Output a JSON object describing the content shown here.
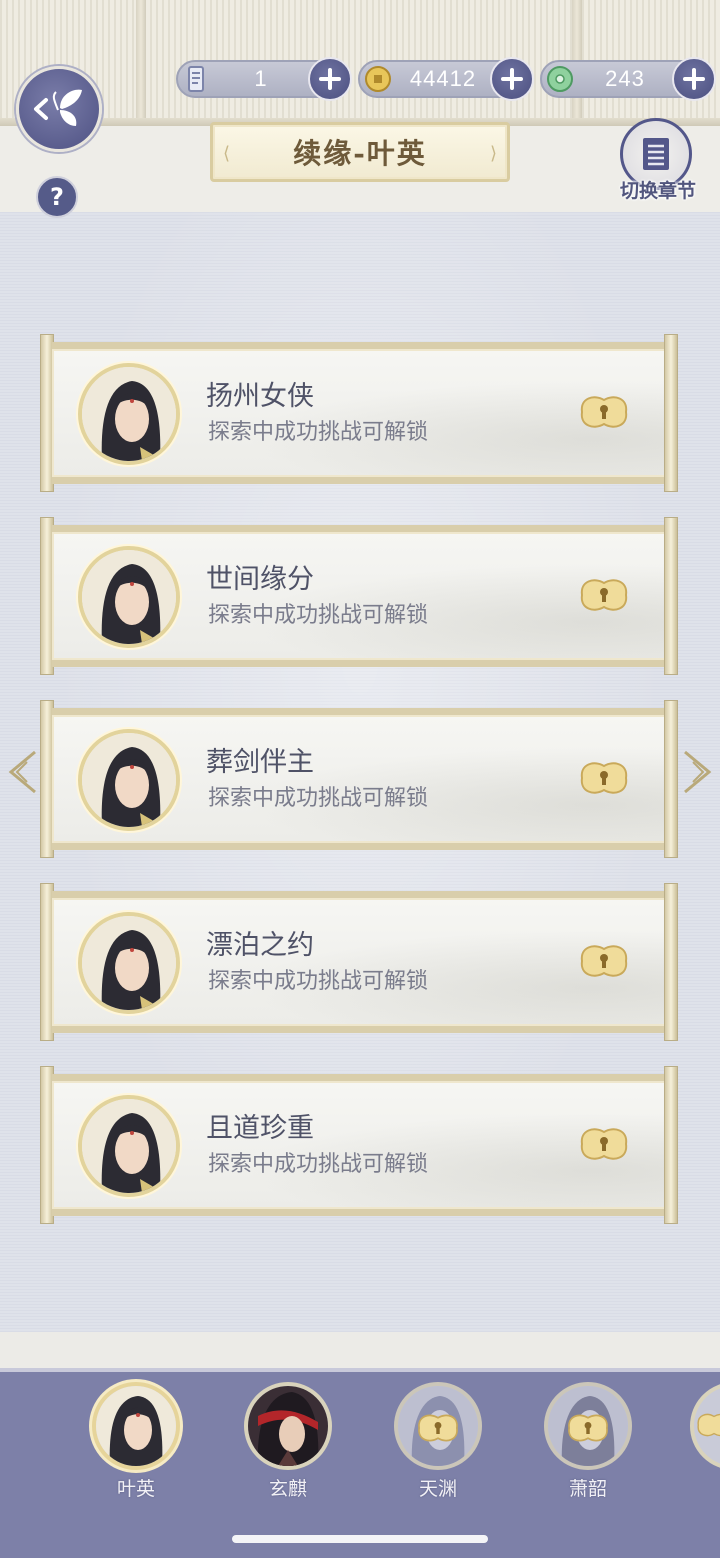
{
  "header": {
    "title": "续缘-叶英",
    "switch_chapter_label": "切换章节"
  },
  "currencies": [
    {
      "name": "scroll-token",
      "icon": "scroll-icon",
      "value": "1"
    },
    {
      "name": "copper-coin",
      "icon": "coin-icon",
      "value": "44412"
    },
    {
      "name": "jade",
      "icon": "jade-icon",
      "value": "243"
    }
  ],
  "stories": [
    {
      "title": "扬州女侠",
      "hint": "探索中成功挑战可解锁",
      "locked": true
    },
    {
      "title": "世间缘分",
      "hint": "探索中成功挑战可解锁",
      "locked": true
    },
    {
      "title": "葬剑伴主",
      "hint": "探索中成功挑战可解锁",
      "locked": true
    },
    {
      "title": "漂泊之约",
      "hint": "探索中成功挑战可解锁",
      "locked": true
    },
    {
      "title": "且道珍重",
      "hint": "探索中成功挑战可解锁",
      "locked": true
    }
  ],
  "characters": [
    {
      "name": "叶英",
      "active": true,
      "locked": false
    },
    {
      "name": "玄麒",
      "active": false,
      "locked": false
    },
    {
      "name": "天渊",
      "active": false,
      "locked": true
    },
    {
      "name": "萧韶",
      "active": false,
      "locked": true
    }
  ],
  "colors": {
    "accent": "#4e5183",
    "gold": "#e2d39c",
    "bottom_bar": "#7d80a8"
  }
}
